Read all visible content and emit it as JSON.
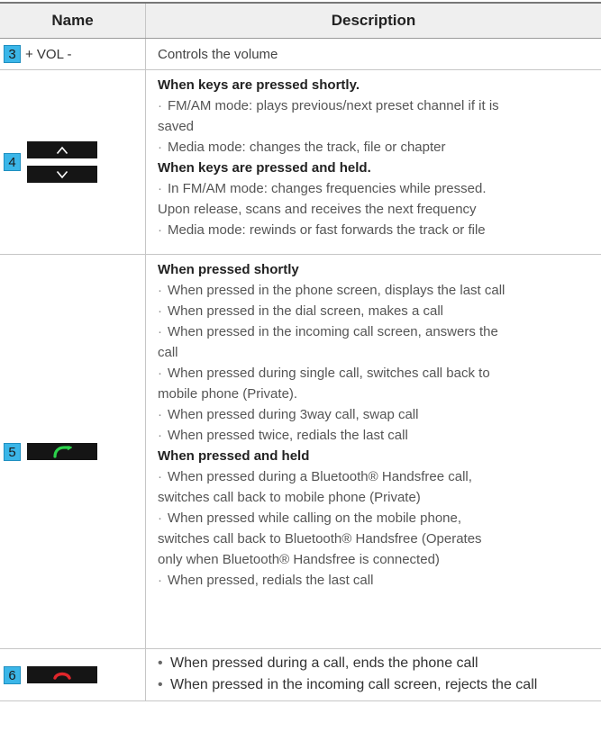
{
  "header": {
    "name": "Name",
    "description": "Description"
  },
  "rows": [
    {
      "number": "3",
      "key_label": "+ VOL -",
      "description": "Controls the volume"
    },
    {
      "number": "4",
      "key_icons": [
        "chevron-up-icon",
        "chevron-down-icon"
      ],
      "lines": [
        "When keys are pressed shortly.",
        "FM/AM mode: plays previous/next preset channel if it is",
        "saved",
        "Media mode: changes the track, file or chapter",
        "When keys are pressed and held.",
        "In FM/AM mode: changes frequencies while pressed.",
        "Upon release, scans and receives the next frequency",
        "Media mode: rewinds or fast forwards the track or file"
      ]
    },
    {
      "number": "5",
      "key_icon": "call-answer-icon",
      "key_icon_color": "#2bd24b",
      "lines": [
        "When pressed shortly",
        "When pressed in the phone screen, displays the last call",
        "When pressed in the dial screen, makes a call",
        "When pressed in the incoming call screen, answers the",
        "call",
        "When pressed during single call, switches call back to",
        "mobile phone (Private).",
        "When pressed during 3way call, swap call",
        "When pressed twice, redials the last call",
        "When pressed and held",
        "When pressed during a Bluetooth® Handsfree call,",
        "switches call back to mobile phone (Private)",
        "When pressed while calling on the mobile phone,",
        "switches call back to Bluetooth® Handsfree (Operates",
        "only when Bluetooth® Handsfree is connected)",
        "When pressed, redials the last call"
      ]
    },
    {
      "number": "6",
      "key_icon": "call-end-icon",
      "key_icon_color": "#e0262b",
      "lines": [
        "When pressed during a call, ends the phone call",
        "When pressed in the incoming call screen, rejects the call"
      ]
    }
  ],
  "colors": {
    "number_badge": "#3bb6e8",
    "header_bg": "#efefef",
    "key_bg": "#151515"
  }
}
